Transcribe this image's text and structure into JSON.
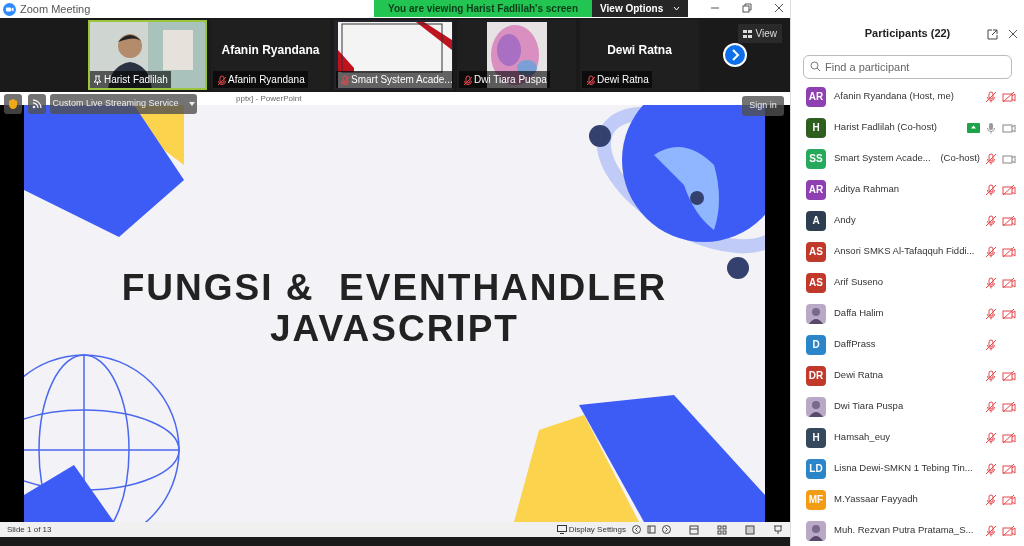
{
  "window": {
    "title": "Zoom Meeting"
  },
  "banner": {
    "text": "You are viewing Harist Fadlilah's screen",
    "button": "View Options"
  },
  "video_tiles": [
    {
      "name": "Harist Fadlilah",
      "kind": "person",
      "muted": false,
      "pinned": true,
      "active": true
    },
    {
      "name": "Afanin Ryandana",
      "kind": "name",
      "display": "Afanin Ryandana",
      "muted": true,
      "pinned": false,
      "active": false
    },
    {
      "name": "Smart System Acade...",
      "kind": "screen",
      "muted": true,
      "pinned": false,
      "active": false
    },
    {
      "name": "Dwi Tiara Puspa",
      "kind": "abstract",
      "muted": true,
      "pinned": false,
      "active": false
    },
    {
      "name": "Dewi Ratna",
      "kind": "name",
      "display": "Dewi Ratna",
      "muted": true,
      "pinned": false,
      "active": false
    }
  ],
  "view_button": "View",
  "shared_screen": {
    "window_title": "pptx] - PowerPoint",
    "stream_menu": "Custom Live Streaming Service",
    "sign_in": "Sign in",
    "slide_title": [
      "FUNGSI &  EVENTHANDLER",
      "JAVASCRIPT"
    ],
    "status": "Slide 1 of 13",
    "display_settings": "Display Settings"
  },
  "participants": {
    "title": "Participants (22)",
    "search": {
      "placeholder": "Find a participant"
    },
    "items": [
      {
        "name": "Afanin Ryandana (Host, me)",
        "kind": "initials",
        "initials": "AR",
        "color": "#8e3fb2",
        "sharing": false,
        "muted": true,
        "video_muted": true
      },
      {
        "name": "Harist Fadlilah (Co-host)",
        "kind": "initials",
        "initials": "H",
        "color": "#2f5f1f",
        "sharing": true,
        "muted": false,
        "video_muted": false
      },
      {
        "name": "Smart System Acade...",
        "role": "(Co-host)",
        "kind": "initials",
        "initials": "SS",
        "color": "#27a95b",
        "sharing": false,
        "muted": true,
        "video_muted": false
      },
      {
        "name": "Aditya Rahman",
        "kind": "initials",
        "initials": "AR",
        "color": "#8e3fb2",
        "sharing": false,
        "muted": true,
        "video_muted": true
      },
      {
        "name": "Andy",
        "kind": "initials",
        "initials": "A",
        "color": "#2c3e50",
        "sharing": false,
        "muted": true,
        "video_muted": true
      },
      {
        "name": "Ansori SMKS Al-Tafaqquh Fiddi...",
        "kind": "initials",
        "initials": "AS",
        "color": "#c0392b",
        "sharing": false,
        "muted": true,
        "video_muted": true
      },
      {
        "name": "Arif Suseno",
        "kind": "initials",
        "initials": "AS",
        "color": "#c0392b",
        "sharing": false,
        "muted": true,
        "video_muted": true
      },
      {
        "name": "Daffa Halim",
        "kind": "picture",
        "sharing": false,
        "muted": true,
        "video_muted": true
      },
      {
        "name": "DaffPrass",
        "kind": "initials",
        "initials": "D",
        "color": "#2a86c8",
        "sharing": false,
        "muted": true
      },
      {
        "name": "Dewi Ratna",
        "kind": "initials",
        "initials": "DR",
        "color": "#c0392b",
        "sharing": false,
        "muted": true,
        "video_muted": true
      },
      {
        "name": "Dwi Tiara Puspa",
        "kind": "picture",
        "sharing": false,
        "muted": true,
        "video_muted": true
      },
      {
        "name": "Hamsah_euy",
        "kind": "initials",
        "initials": "H",
        "color": "#34495e",
        "sharing": false,
        "muted": true,
        "video_muted": true
      },
      {
        "name": "Lisna Dewi-SMKN 1 Tebing Tin...",
        "kind": "initials",
        "initials": "LD",
        "color": "#2a86c8",
        "sharing": false,
        "muted": true,
        "video_muted": true
      },
      {
        "name": "M.Yassaar Fayyadh",
        "kind": "initials",
        "initials": "MF",
        "color": "#f39c12",
        "sharing": false,
        "muted": true,
        "video_muted": true
      },
      {
        "name": "Muh. Rezvan Putra Pratama_S...",
        "kind": "picture",
        "sharing": false,
        "muted": true,
        "video_muted": true
      }
    ]
  }
}
